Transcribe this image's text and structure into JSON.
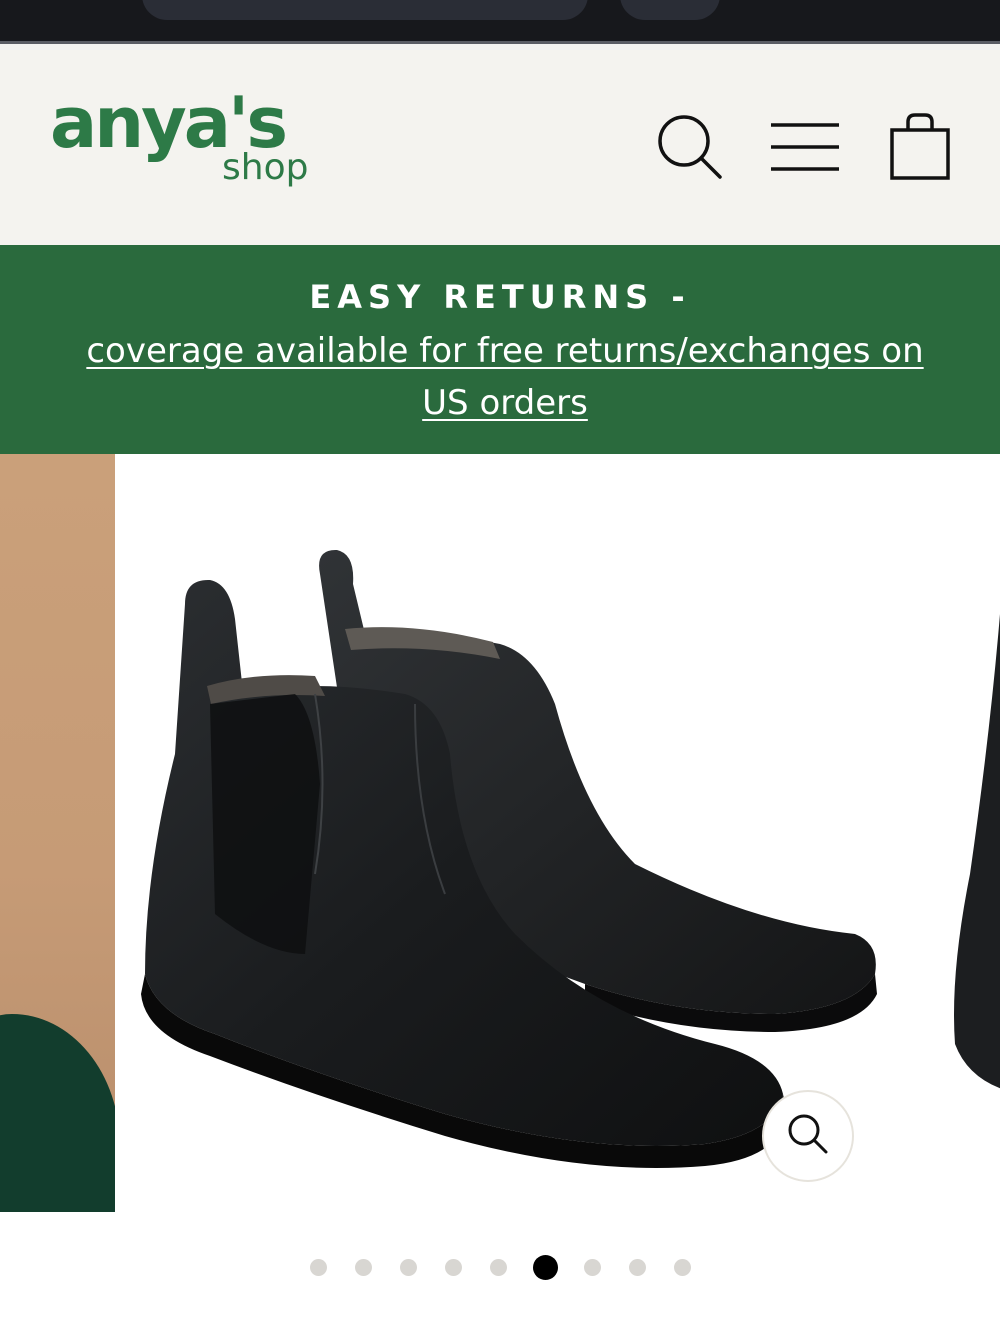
{
  "header": {
    "logo_text": "anya's",
    "logo_subtext": "shop",
    "brand_color": "#2d7a47",
    "icons": [
      "search-icon",
      "menu-icon",
      "cart-icon"
    ]
  },
  "promo": {
    "headline": "EASY RETURNS -",
    "link_text": "coverage available for free returns/exchanges on US orders",
    "background_color": "#2a6a3d"
  },
  "gallery": {
    "zoom_icon": "zoom-icon",
    "slide_count": 9,
    "active_slide": 6
  }
}
